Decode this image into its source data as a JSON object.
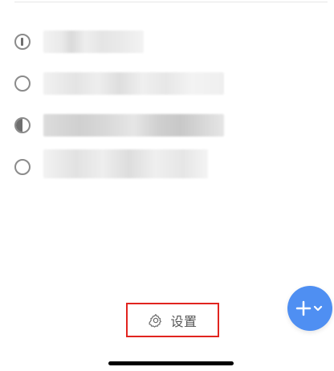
{
  "settings": {
    "label": "设置",
    "icon": "gear-icon"
  },
  "tasks": [
    {
      "status_icon": "circle-bar-icon"
    },
    {
      "status_icon": "circle-empty-icon"
    },
    {
      "status_icon": "circle-half-icon"
    },
    {
      "status_icon": "circle-empty-icon"
    }
  ],
  "fab": {
    "icons": [
      "plus-icon",
      "chevron-down-icon"
    ],
    "color": "#4f8ff2"
  },
  "highlight_color": "#e1241f"
}
